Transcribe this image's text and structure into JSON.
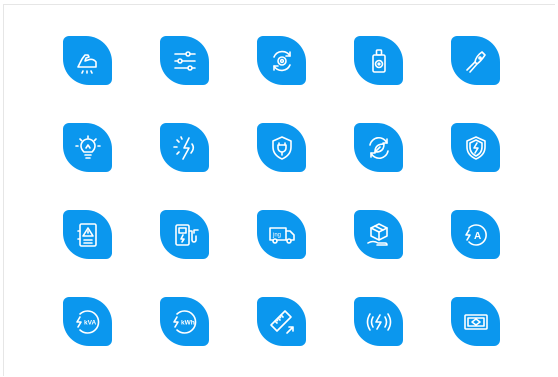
{
  "background": "#ffffff",
  "tile_color": "#0b97ee",
  "icon_color": "#ffffff",
  "icons": [
    {
      "name": "strength-flexed-arm-icon"
    },
    {
      "name": "settings-sliders-icon"
    },
    {
      "name": "gear-refresh-icon"
    },
    {
      "name": "power-socket-switch-icon"
    },
    {
      "name": "wire-stripper-pliers-icon"
    },
    {
      "name": "light-bulb-icon"
    },
    {
      "name": "lightning-sun-icon"
    },
    {
      "name": "shield-plug-icon"
    },
    {
      "name": "eco-refresh-leaf-icon"
    },
    {
      "name": "shield-lightning-icon"
    },
    {
      "name": "electrical-panel-warning-icon"
    },
    {
      "name": "ev-charging-station-icon"
    },
    {
      "name": "delivery-van-icon"
    },
    {
      "name": "hand-package-icon"
    },
    {
      "name": "ampere-lightning-icon"
    },
    {
      "name": "kva-lightning-icon"
    },
    {
      "name": "kwh-lightning-icon"
    },
    {
      "name": "measuring-ruler-icon"
    },
    {
      "name": "wireless-lightning-icon"
    },
    {
      "name": "banknote-icon"
    }
  ],
  "labels": {
    "jng": "jng",
    "kva": "kVA",
    "kwh": "kWh",
    "ampere": "A"
  }
}
